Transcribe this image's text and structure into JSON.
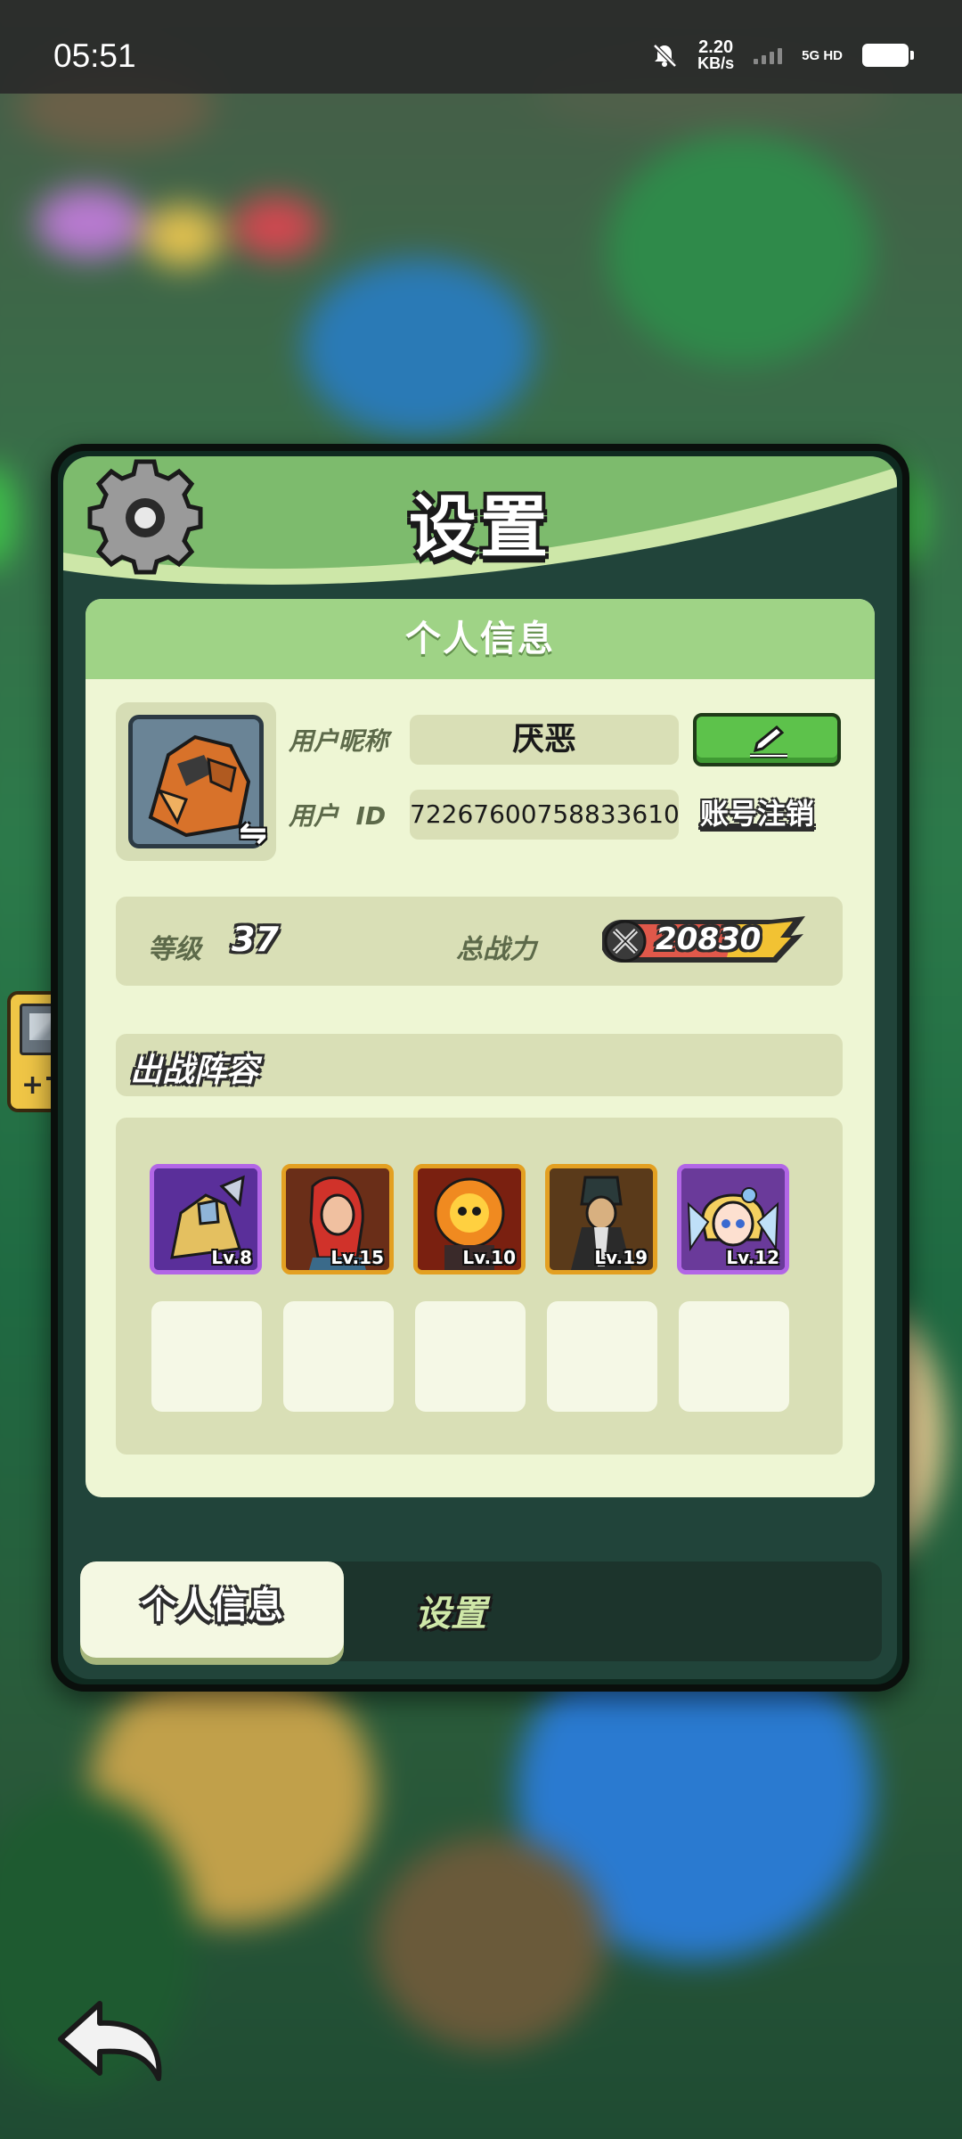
{
  "status_bar": {
    "time": "05:51",
    "net_speed_value": "2.20",
    "net_speed_unit": "KB/s",
    "network_label": "5G HD",
    "icons": [
      "bell-muted-icon",
      "signal-icon",
      "battery-icon"
    ]
  },
  "dialog": {
    "title": "设置",
    "icon": "gear-icon"
  },
  "profile": {
    "section_title": "个人信息",
    "nickname_label": "用户昵称",
    "nickname_value": "厌恶",
    "id_label": "用户  ID",
    "id_value": "72267600758833610",
    "edit_icon": "pencil-icon",
    "cancel_account_label": "账号注销",
    "level_label": "等级",
    "level_value": "37",
    "power_label": "总战力",
    "power_value": "20830"
  },
  "lineup": {
    "title": "出战阵容",
    "heroes": [
      {
        "level": "Lv.8",
        "rarity": "purple"
      },
      {
        "level": "Lv.15",
        "rarity": "orange"
      },
      {
        "level": "Lv.10",
        "rarity": "orange"
      },
      {
        "level": "Lv.19",
        "rarity": "orange"
      },
      {
        "level": "Lv.12",
        "rarity": "purple"
      }
    ],
    "empty_slots": 5
  },
  "tabs": {
    "active": "个人信息",
    "inactive": "设置"
  },
  "colors": {
    "header_green": "#7dbb6d",
    "card_bg": "#eef6d4",
    "edit_button_green": "#5dc24b",
    "purple_frame": "#b266e6",
    "orange_frame": "#e3a022"
  }
}
